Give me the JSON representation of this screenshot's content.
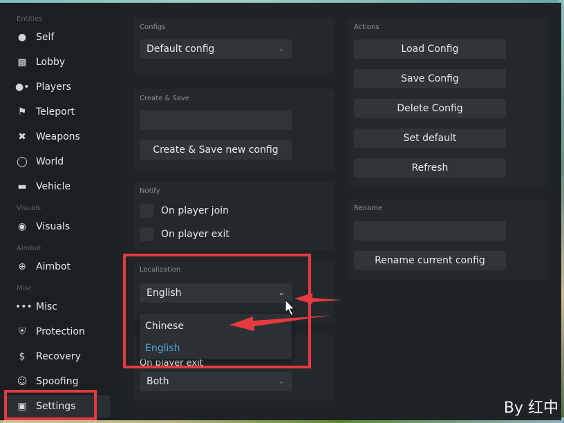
{
  "sidebar": {
    "sections": {
      "entities": "Entities",
      "visuals": "Visuals",
      "aimbot": "Aimbot",
      "misc": "Misc"
    },
    "items": [
      {
        "label": "Self",
        "icon": "person-icon"
      },
      {
        "label": "Lobby",
        "icon": "lobby-icon"
      },
      {
        "label": "Players",
        "icon": "players-icon"
      },
      {
        "label": "Teleport",
        "icon": "teleport-icon"
      },
      {
        "label": "Weapons",
        "icon": "weapon-icon"
      },
      {
        "label": "World",
        "icon": "globe-icon"
      },
      {
        "label": "Vehicle",
        "icon": "car-icon"
      },
      {
        "label": "Visuals",
        "icon": "eye-icon"
      },
      {
        "label": "Aimbot",
        "icon": "crosshair-icon"
      },
      {
        "label": "Misc",
        "icon": "dots-icon"
      },
      {
        "label": "Protection",
        "icon": "shield-icon"
      },
      {
        "label": "Recovery",
        "icon": "dollar-icon"
      },
      {
        "label": "Spoofing",
        "icon": "mask-icon"
      },
      {
        "label": "Settings",
        "icon": "save-icon"
      }
    ],
    "active": "Settings"
  },
  "configs": {
    "title": "Configs",
    "selected": "Default config"
  },
  "create_save": {
    "title": "Create & Save",
    "input_value": "",
    "button": "Create & Save new config"
  },
  "notify": {
    "title": "Notify",
    "options": [
      "On player join",
      "On player exit"
    ]
  },
  "localization": {
    "title": "Localization",
    "selected": "English",
    "options": [
      "Chinese",
      "English"
    ]
  },
  "hidden_card": {
    "partial_label": "On player exit",
    "selected": "Both"
  },
  "actions": {
    "title": "Actions",
    "buttons": [
      "Load Config",
      "Save Config",
      "Delete Config",
      "Set default",
      "Refresh"
    ]
  },
  "rename": {
    "title": "Rename",
    "input_value": "",
    "button": "Rename current config"
  },
  "watermark": "By 红中",
  "colors": {
    "highlight": "#e63a3f",
    "selected_option": "#4aa8d8"
  }
}
